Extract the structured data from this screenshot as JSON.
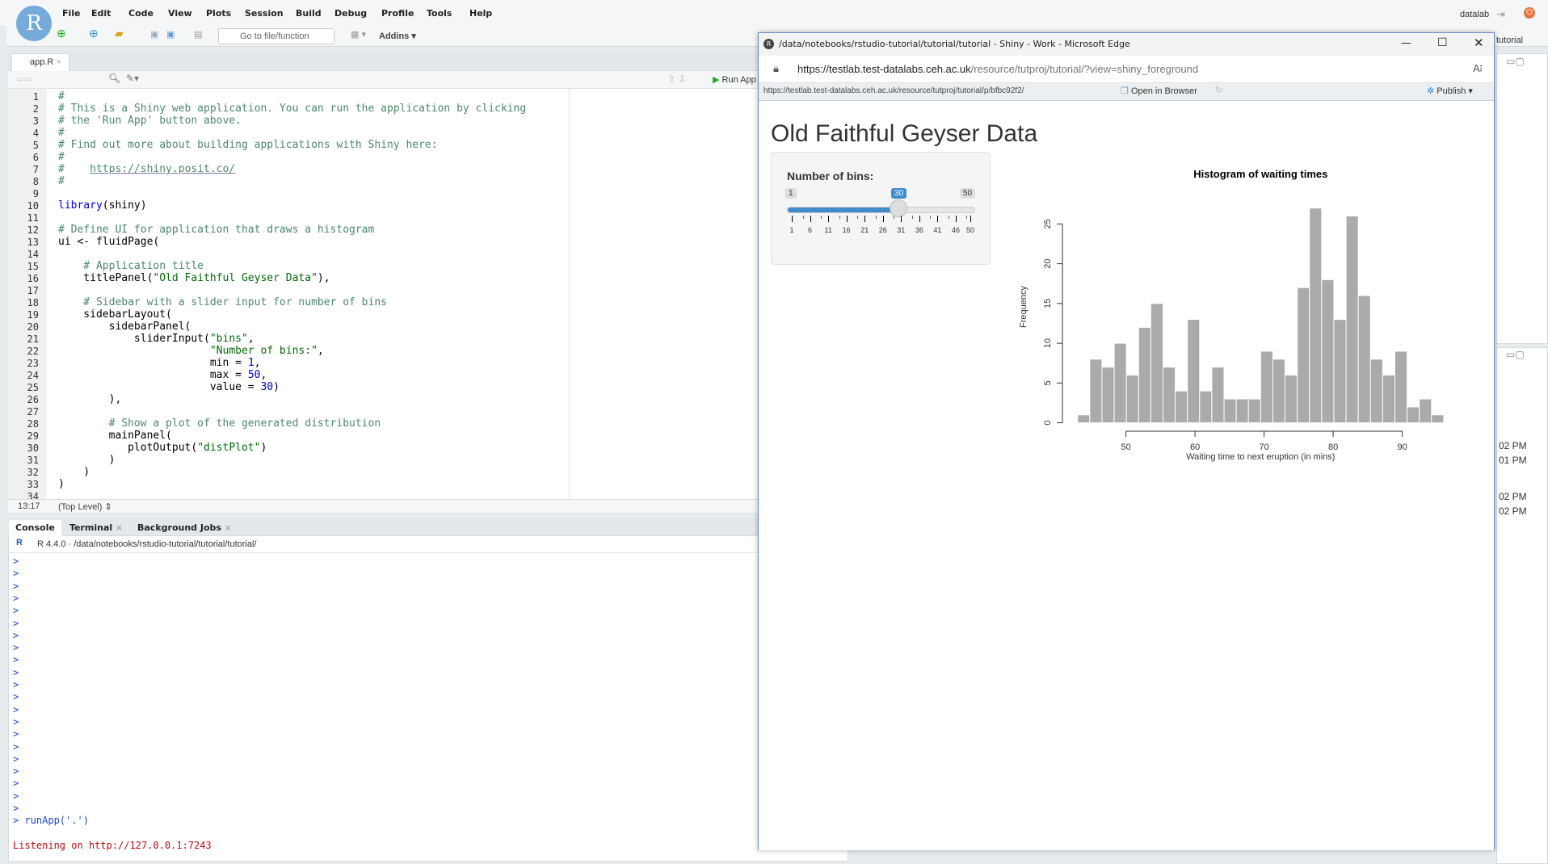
{
  "menubar": {
    "logo": "R",
    "items": [
      "File",
      "Edit",
      "Code",
      "View",
      "Plots",
      "Session",
      "Build",
      "Debug",
      "Profile",
      "Tools",
      "Help"
    ],
    "user": "datalab",
    "project": "tutorial"
  },
  "toolbar": {
    "goto_placeholder": "Go to file/function",
    "addins": "Addins"
  },
  "source": {
    "tab": "app.R",
    "run_app": "Run App",
    "cursor": "13:17",
    "scope": "(Top Level)",
    "lines": [
      [
        [
          "c",
          "#"
        ]
      ],
      [
        [
          "c",
          "# This is a Shiny web application. You can run the application by clicking"
        ]
      ],
      [
        [
          "c",
          "# the 'Run App' button above."
        ]
      ],
      [
        [
          "c",
          "#"
        ]
      ],
      [
        [
          "c",
          "# Find out more about building applications with Shiny here:"
        ]
      ],
      [
        [
          "c",
          "#"
        ]
      ],
      [
        [
          "c",
          "#    "
        ],
        [
          "l",
          "https://shiny.posit.co/"
        ]
      ],
      [
        [
          "c",
          "#"
        ]
      ],
      [],
      [
        [
          "k",
          "library"
        ],
        [
          "p",
          "(shiny)"
        ]
      ],
      [],
      [
        [
          "c",
          "# Define UI for application that draws a histogram"
        ]
      ],
      [
        [
          "p",
          "ui <- fluidPage("
        ]
      ],
      [],
      [
        [
          "c",
          "    # Application title"
        ]
      ],
      [
        [
          "p",
          "    titlePanel("
        ],
        [
          "s",
          "\"Old Faithful Geyser Data\""
        ],
        [
          "p",
          "),"
        ]
      ],
      [],
      [
        [
          "c",
          "    # Sidebar with a slider input for number of bins"
        ]
      ],
      [
        [
          "p",
          "    sidebarLayout("
        ]
      ],
      [
        [
          "p",
          "        sidebarPanel("
        ]
      ],
      [
        [
          "p",
          "            sliderInput("
        ],
        [
          "s",
          "\"bins\""
        ],
        [
          "p",
          ","
        ]
      ],
      [
        [
          "p",
          "                        "
        ],
        [
          "s",
          "\"Number of bins:\""
        ],
        [
          "p",
          ","
        ]
      ],
      [
        [
          "p",
          "                        min = "
        ],
        [
          "n",
          "1"
        ],
        [
          "p",
          ","
        ]
      ],
      [
        [
          "p",
          "                        max = "
        ],
        [
          "n",
          "50"
        ],
        [
          "p",
          ","
        ]
      ],
      [
        [
          "p",
          "                        value = "
        ],
        [
          "n",
          "30"
        ],
        [
          "p",
          ")"
        ]
      ],
      [
        [
          "p",
          "        ),"
        ]
      ],
      [],
      [
        [
          "c",
          "        # Show a plot of the generated distribution"
        ]
      ],
      [
        [
          "p",
          "        mainPanel("
        ]
      ],
      [
        [
          "p",
          "           plotOutput("
        ],
        [
          "s",
          "\"distPlot\""
        ],
        [
          "p",
          ")"
        ]
      ],
      [
        [
          "p",
          "        )"
        ]
      ],
      [
        [
          "p",
          "    )"
        ]
      ],
      [
        [
          "p",
          ")"
        ]
      ],
      []
    ]
  },
  "console": {
    "tabs": [
      "Console",
      "Terminal",
      "Background Jobs"
    ],
    "version": "R 4.4.0",
    "path": "/data/notebooks/rstudio-tutorial/tutorial/tutorial/",
    "empty_prompts": 21,
    "prompt": ">",
    "command": "runApp('.')",
    "output": "Listening on http://127.0.0.1:7243"
  },
  "right_panel": {
    "times": [
      "02 PM",
      "01 PM",
      "02 PM",
      "02 PM"
    ]
  },
  "browser": {
    "title": "/data/notebooks/rstudio-tutorial/tutorial/tutorial - Shiny - Work - Microsoft Edge",
    "url_host": "https://testlab.test-datalabs.ceh.ac.uk",
    "url_path": "/resource/tutproj/tutorial/?view=shiny_foreground",
    "shiny_url": "https://testlab.test-datalabs.ceh.ac.uk/resource/tutproj/tutorial/p/bfbc92f2/",
    "open_in_browser": "Open in Browser",
    "publish": "Publish"
  },
  "app": {
    "title": "Old Faithful Geyser Data",
    "slider": {
      "label": "Number of bins:",
      "min": 1,
      "max": 50,
      "value": 30,
      "grid": [
        1,
        6,
        11,
        16,
        21,
        26,
        31,
        36,
        41,
        46,
        50
      ],
      "min_label": "1",
      "max_label": "50",
      "value_label": "30",
      "accent": "#428bca"
    }
  },
  "chart_data": {
    "type": "bar",
    "title": "Histogram of waiting times",
    "xlabel": "Waiting time to next eruption (in mins)",
    "ylabel": "Frequency",
    "bin_start": 43,
    "bin_end": 96,
    "values": [
      1,
      8,
      7,
      10,
      6,
      12,
      15,
      7,
      4,
      13,
      4,
      7,
      3,
      3,
      3,
      9,
      8,
      6,
      17,
      27,
      18,
      13,
      26,
      16,
      8,
      6,
      9,
      2,
      3,
      1
    ],
    "xticks": [
      50,
      60,
      70,
      80,
      90
    ],
    "yticks": [
      0,
      5,
      10,
      15,
      20,
      25
    ],
    "bar_color": "#aaaaaa",
    "border_color": "#ffffff",
    "grid": false
  }
}
